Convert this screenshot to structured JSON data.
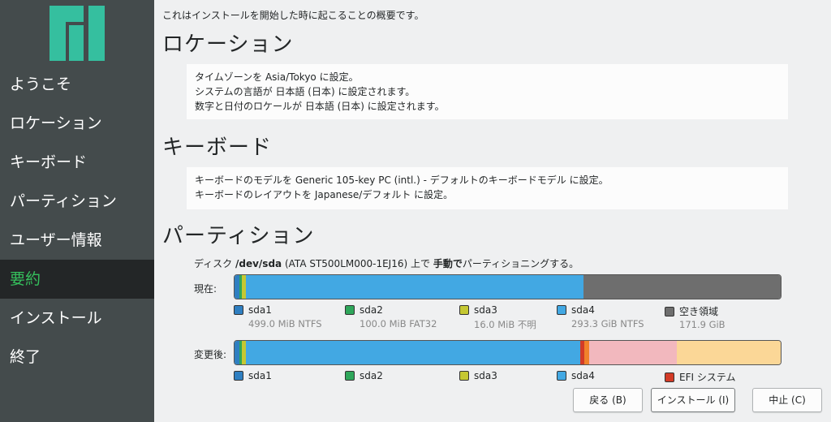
{
  "colors": {
    "sidebar_bg": "#444b4c",
    "active_bg": "#232627",
    "active_text": "#35bf5c",
    "logo": "#35bf9f",
    "sda1": "#2f7fc1",
    "sda2": "#2ea65a",
    "sda3": "#c5c832",
    "sda4": "#42a8e3",
    "free": "#6e6e6e",
    "efi": "#d33b27",
    "pink": "#f2b8be",
    "tan": "#fbd797"
  },
  "sidebar": {
    "logo_icon": "manjaro-logo-icon",
    "items": [
      {
        "label": "ようこそ"
      },
      {
        "label": "ロケーション"
      },
      {
        "label": "キーボード"
      },
      {
        "label": "パーティション"
      },
      {
        "label": "ユーザー情報"
      },
      {
        "label": "要約"
      },
      {
        "label": "インストール"
      },
      {
        "label": "終了"
      }
    ]
  },
  "summary": {
    "intro": "これはインストールを開始した時に起こることの概要です。",
    "location": {
      "title": "ロケーション",
      "lines": [
        "タイムゾーンを Asia/Tokyo に設定。",
        "システムの言語が 日本語 (日本) に設定されます。",
        "数字と日付のロケールが 日本語 (日本) に設定されます。"
      ]
    },
    "keyboard": {
      "title": "キーボード",
      "lines": [
        "キーボードのモデルを Generic 105-key PC (intl.) - デフォルトのキーボードモデル に設定。",
        "キーボードのレイアウトを Japanese/デフォルト に設定。"
      ]
    },
    "partition": {
      "title": "パーティション",
      "desc_prefix": "ディスク ",
      "desc_disk": "/dev/sda",
      "desc_model": " (ATA ST500LM000-1EJ16) 上で ",
      "desc_mode": "手動で",
      "desc_suffix": "パーティショニングする。",
      "current_label": "現在:",
      "after_label": "変更後:",
      "current_legend": [
        {
          "name": "sda1",
          "detail": "499.0 MiB  NTFS",
          "color": "#2f7fc1"
        },
        {
          "name": "sda2",
          "detail": "100.0 MiB  FAT32",
          "color": "#2ea65a"
        },
        {
          "name": "sda3",
          "detail": "16.0 MiB  不明",
          "color": "#c5c832"
        },
        {
          "name": "sda4",
          "detail": "293.3 GiB  NTFS",
          "color": "#42a8e3"
        },
        {
          "name": "空き領域",
          "detail": "171.9 GiB",
          "color": "#6e6e6e"
        }
      ],
      "after_legend": [
        {
          "name": "sda1",
          "color": "#2f7fc1"
        },
        {
          "name": "sda2",
          "color": "#2ea65a"
        },
        {
          "name": "sda3",
          "color": "#c5c832"
        },
        {
          "name": "sda4",
          "color": "#42a8e3"
        },
        {
          "name": "EFI システム",
          "color": "#d33b27"
        }
      ]
    }
  },
  "buttons": {
    "back": "戻る (B)",
    "install": "インストール (I)",
    "cancel": "中止 (C)"
  }
}
